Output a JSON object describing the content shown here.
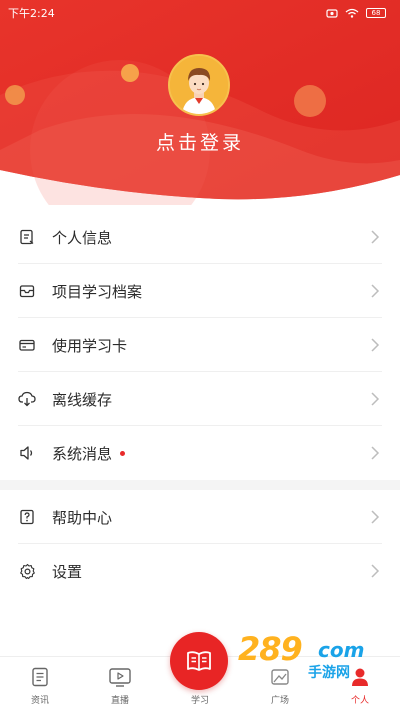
{
  "status_bar": {
    "time": "下午2:24",
    "battery": "68"
  },
  "header": {
    "login_text": "点击登录"
  },
  "menu": {
    "items": [
      {
        "label": "个人信息",
        "icon": "profile-icon"
      },
      {
        "label": "项目学习档案",
        "icon": "archive-icon"
      },
      {
        "label": "使用学习卡",
        "icon": "card-icon"
      },
      {
        "label": "离线缓存",
        "icon": "cloud-download-icon"
      },
      {
        "label": "系统消息",
        "icon": "speaker-icon",
        "badge": "red-dot"
      }
    ],
    "items2": [
      {
        "label": "帮助中心",
        "icon": "help-icon"
      },
      {
        "label": "设置",
        "icon": "gear-icon"
      }
    ]
  },
  "tabbar": {
    "tabs": [
      {
        "label": "资讯",
        "icon": "news-icon"
      },
      {
        "label": "直播",
        "icon": "live-icon"
      },
      {
        "label": "学习",
        "icon": "book-icon"
      },
      {
        "label": "广场",
        "icon": "plaza-icon"
      },
      {
        "label": "个人",
        "icon": "person-icon",
        "active": true
      }
    ]
  },
  "watermark": {
    "number": "289",
    "domain": "com",
    "sub": "手游网"
  },
  "colors": {
    "accent": "#e82a2a",
    "header_red": "#e5302a"
  }
}
